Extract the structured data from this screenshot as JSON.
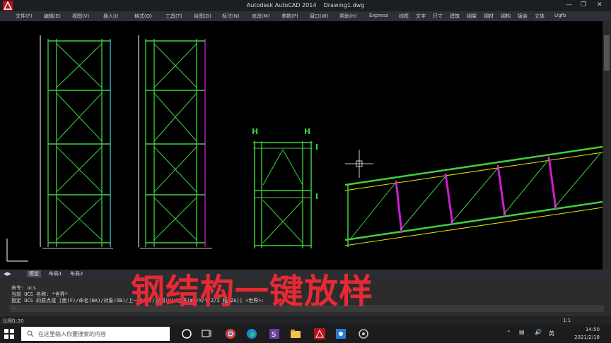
{
  "titlebar": {
    "app_name": "Autodesk AutoCAD 2014",
    "doc_name": "Drawing1.dwg"
  },
  "menu": [
    "文件(F)",
    "编辑(E)",
    "视图(V)",
    "插入(I)",
    "格式(O)",
    "工具(T)",
    "绘图(D)",
    "标注(N)",
    "修改(M)",
    "参数(P)",
    "窗口(W)",
    "帮助(H)",
    "Express",
    "线框",
    "文字",
    "尺寸",
    "建筑",
    "钢架",
    "钢材",
    "钢构",
    "钣金",
    "立体",
    "Ugfb"
  ],
  "drawing": {
    "marker_h": "H",
    "marker_i": "I"
  },
  "tabs": [
    "模型",
    "布局1",
    "布局2"
  ],
  "command_lines": [
    "命令: ucs",
    "当前 UCS 名称: *世界*",
    "指定 UCS 的原点或 [面(F)/命名(NA)/对象(OB)/上一个(P)/视图(V)/世界(W)/X/Y/Z/Z 轴(ZA)] <世界>:"
  ],
  "command_prompt": "-",
  "overlay_caption": "钢结构一键放样",
  "status": {
    "scale": "比例1:20",
    "anno": "1:1"
  },
  "taskbar": {
    "search_placeholder": "在这里输入你要搜索的内容",
    "lang": "英",
    "time": "14:50",
    "date": "2021/2/18"
  },
  "colors": {
    "accent_red": "#e52a35",
    "line_green": "#3fd13f",
    "line_cyan": "#3fc6d8",
    "line_magenta": "#d21ad2",
    "line_yellow": "#e8e800"
  }
}
